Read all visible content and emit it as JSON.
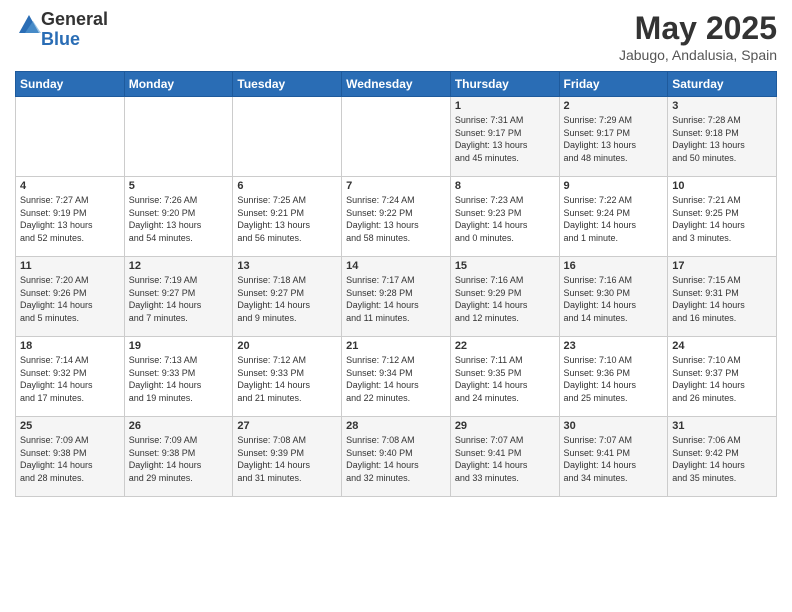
{
  "logo": {
    "general": "General",
    "blue": "Blue"
  },
  "title": "May 2025",
  "location": "Jabugo, Andalusia, Spain",
  "days_of_week": [
    "Sunday",
    "Monday",
    "Tuesday",
    "Wednesday",
    "Thursday",
    "Friday",
    "Saturday"
  ],
  "weeks": [
    [
      {
        "day": "",
        "content": ""
      },
      {
        "day": "",
        "content": ""
      },
      {
        "day": "",
        "content": ""
      },
      {
        "day": "",
        "content": ""
      },
      {
        "day": "1",
        "content": "Sunrise: 7:31 AM\nSunset: 9:17 PM\nDaylight: 13 hours\nand 45 minutes."
      },
      {
        "day": "2",
        "content": "Sunrise: 7:29 AM\nSunset: 9:17 PM\nDaylight: 13 hours\nand 48 minutes."
      },
      {
        "day": "3",
        "content": "Sunrise: 7:28 AM\nSunset: 9:18 PM\nDaylight: 13 hours\nand 50 minutes."
      }
    ],
    [
      {
        "day": "4",
        "content": "Sunrise: 7:27 AM\nSunset: 9:19 PM\nDaylight: 13 hours\nand 52 minutes."
      },
      {
        "day": "5",
        "content": "Sunrise: 7:26 AM\nSunset: 9:20 PM\nDaylight: 13 hours\nand 54 minutes."
      },
      {
        "day": "6",
        "content": "Sunrise: 7:25 AM\nSunset: 9:21 PM\nDaylight: 13 hours\nand 56 minutes."
      },
      {
        "day": "7",
        "content": "Sunrise: 7:24 AM\nSunset: 9:22 PM\nDaylight: 13 hours\nand 58 minutes."
      },
      {
        "day": "8",
        "content": "Sunrise: 7:23 AM\nSunset: 9:23 PM\nDaylight: 14 hours\nand 0 minutes."
      },
      {
        "day": "9",
        "content": "Sunrise: 7:22 AM\nSunset: 9:24 PM\nDaylight: 14 hours\nand 1 minute."
      },
      {
        "day": "10",
        "content": "Sunrise: 7:21 AM\nSunset: 9:25 PM\nDaylight: 14 hours\nand 3 minutes."
      }
    ],
    [
      {
        "day": "11",
        "content": "Sunrise: 7:20 AM\nSunset: 9:26 PM\nDaylight: 14 hours\nand 5 minutes."
      },
      {
        "day": "12",
        "content": "Sunrise: 7:19 AM\nSunset: 9:27 PM\nDaylight: 14 hours\nand 7 minutes."
      },
      {
        "day": "13",
        "content": "Sunrise: 7:18 AM\nSunset: 9:27 PM\nDaylight: 14 hours\nand 9 minutes."
      },
      {
        "day": "14",
        "content": "Sunrise: 7:17 AM\nSunset: 9:28 PM\nDaylight: 14 hours\nand 11 minutes."
      },
      {
        "day": "15",
        "content": "Sunrise: 7:16 AM\nSunset: 9:29 PM\nDaylight: 14 hours\nand 12 minutes."
      },
      {
        "day": "16",
        "content": "Sunrise: 7:16 AM\nSunset: 9:30 PM\nDaylight: 14 hours\nand 14 minutes."
      },
      {
        "day": "17",
        "content": "Sunrise: 7:15 AM\nSunset: 9:31 PM\nDaylight: 14 hours\nand 16 minutes."
      }
    ],
    [
      {
        "day": "18",
        "content": "Sunrise: 7:14 AM\nSunset: 9:32 PM\nDaylight: 14 hours\nand 17 minutes."
      },
      {
        "day": "19",
        "content": "Sunrise: 7:13 AM\nSunset: 9:33 PM\nDaylight: 14 hours\nand 19 minutes."
      },
      {
        "day": "20",
        "content": "Sunrise: 7:12 AM\nSunset: 9:33 PM\nDaylight: 14 hours\nand 21 minutes."
      },
      {
        "day": "21",
        "content": "Sunrise: 7:12 AM\nSunset: 9:34 PM\nDaylight: 14 hours\nand 22 minutes."
      },
      {
        "day": "22",
        "content": "Sunrise: 7:11 AM\nSunset: 9:35 PM\nDaylight: 14 hours\nand 24 minutes."
      },
      {
        "day": "23",
        "content": "Sunrise: 7:10 AM\nSunset: 9:36 PM\nDaylight: 14 hours\nand 25 minutes."
      },
      {
        "day": "24",
        "content": "Sunrise: 7:10 AM\nSunset: 9:37 PM\nDaylight: 14 hours\nand 26 minutes."
      }
    ],
    [
      {
        "day": "25",
        "content": "Sunrise: 7:09 AM\nSunset: 9:38 PM\nDaylight: 14 hours\nand 28 minutes."
      },
      {
        "day": "26",
        "content": "Sunrise: 7:09 AM\nSunset: 9:38 PM\nDaylight: 14 hours\nand 29 minutes."
      },
      {
        "day": "27",
        "content": "Sunrise: 7:08 AM\nSunset: 9:39 PM\nDaylight: 14 hours\nand 31 minutes."
      },
      {
        "day": "28",
        "content": "Sunrise: 7:08 AM\nSunset: 9:40 PM\nDaylight: 14 hours\nand 32 minutes."
      },
      {
        "day": "29",
        "content": "Sunrise: 7:07 AM\nSunset: 9:41 PM\nDaylight: 14 hours\nand 33 minutes."
      },
      {
        "day": "30",
        "content": "Sunrise: 7:07 AM\nSunset: 9:41 PM\nDaylight: 14 hours\nand 34 minutes."
      },
      {
        "day": "31",
        "content": "Sunrise: 7:06 AM\nSunset: 9:42 PM\nDaylight: 14 hours\nand 35 minutes."
      }
    ]
  ]
}
